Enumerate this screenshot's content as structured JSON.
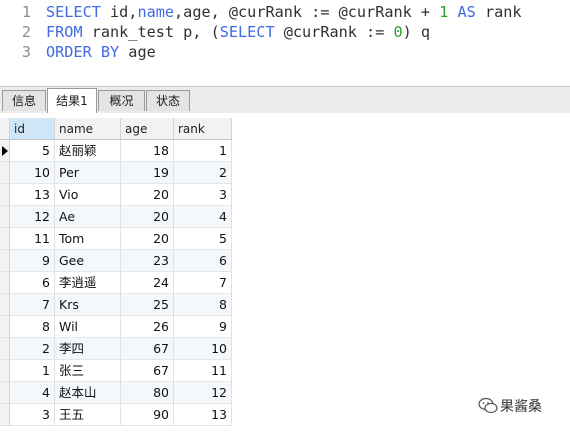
{
  "editor": {
    "lines": [
      {
        "number": "1",
        "tokens": [
          {
            "text": "SELECT",
            "kind": "kw"
          },
          {
            "text": " id,",
            "kind": "txt"
          },
          {
            "text": "name",
            "kind": "kw"
          },
          {
            "text": ",age, @curRank := @curRank + ",
            "kind": "txt"
          },
          {
            "text": "1",
            "kind": "num"
          },
          {
            "text": " ",
            "kind": "txt"
          },
          {
            "text": "AS",
            "kind": "kw"
          },
          {
            "text": " rank",
            "kind": "txt"
          }
        ]
      },
      {
        "number": "2",
        "tokens": [
          {
            "text": "FROM",
            "kind": "kw"
          },
          {
            "text": " rank_test p, (",
            "kind": "txt"
          },
          {
            "text": "SELECT",
            "kind": "kw"
          },
          {
            "text": " @curRank := ",
            "kind": "txt"
          },
          {
            "text": "0",
            "kind": "num"
          },
          {
            "text": ") q",
            "kind": "txt"
          }
        ]
      },
      {
        "number": "3",
        "tokens": [
          {
            "text": "ORDER BY",
            "kind": "kw"
          },
          {
            "text": " age",
            "kind": "txt"
          }
        ]
      }
    ]
  },
  "tabs": [
    {
      "label": "信息",
      "active": false
    },
    {
      "label": "结果1",
      "active": true
    },
    {
      "label": "概况",
      "active": false
    },
    {
      "label": "状态",
      "active": false
    }
  ],
  "grid": {
    "columns": [
      "id",
      "name",
      "age",
      "rank"
    ],
    "selected_column": "id",
    "current_row": 0,
    "rows": [
      [
        "5",
        "赵丽颖",
        "18",
        "1"
      ],
      [
        "10",
        "Per",
        "19",
        "2"
      ],
      [
        "13",
        "Vio",
        "20",
        "3"
      ],
      [
        "12",
        "Ae",
        "20",
        "4"
      ],
      [
        "11",
        "Tom",
        "20",
        "5"
      ],
      [
        "9",
        "Gee",
        "23",
        "6"
      ],
      [
        "6",
        "李逍遥",
        "24",
        "7"
      ],
      [
        "7",
        "Krs",
        "25",
        "8"
      ],
      [
        "8",
        "Wil",
        "26",
        "9"
      ],
      [
        "2",
        "李四",
        "67",
        "10"
      ],
      [
        "1",
        "张三",
        "67",
        "11"
      ],
      [
        "4",
        "赵本山",
        "80",
        "12"
      ],
      [
        "3",
        "王五",
        "90",
        "13"
      ]
    ]
  },
  "watermark": {
    "text": "果酱桑",
    "icon": "wechat-icon"
  },
  "colors": {
    "keyword": "#4169e1",
    "number": "#2e9d2e",
    "selected_header": "#cfe6f7",
    "alt_row": "#f4f8fc"
  }
}
